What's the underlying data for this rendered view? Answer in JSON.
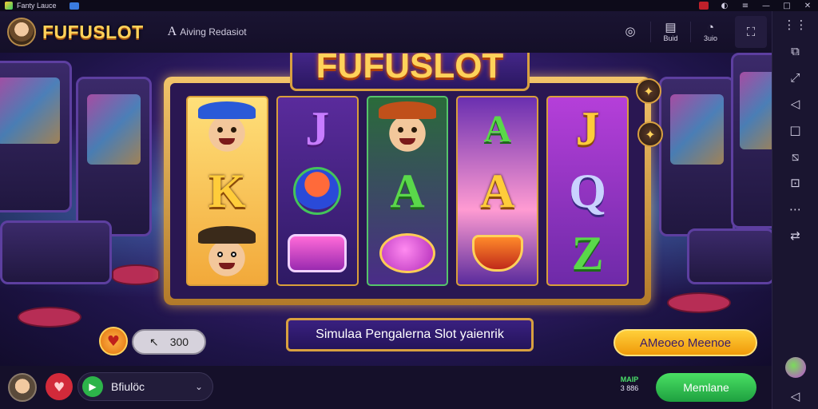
{
  "window": {
    "title": "Fanty Lauce",
    "controls": [
      "◐",
      "≡",
      "—",
      "□",
      "✕"
    ]
  },
  "header": {
    "brand": "FUFUSLOT",
    "icon_a": "A",
    "status": "Aiving Redasiot",
    "tools": [
      {
        "glyph": "◎",
        "label": ""
      },
      {
        "glyph": "▤",
        "label": "Buid"
      },
      {
        "glyph": "◔",
        "label": "3uio"
      },
      {
        "glyph": "⛶",
        "label": ""
      }
    ]
  },
  "game": {
    "logo": "FUFUSLOT",
    "reels": [
      [
        "cowboy-face",
        "K",
        "glasses-face"
      ],
      [
        "J",
        "helmet-face",
        "drum"
      ],
      [
        "hat-face",
        "A",
        "bowl"
      ],
      [
        "A-jewel",
        "A",
        "cup"
      ],
      [
        "J",
        "Q",
        "Z"
      ]
    ],
    "symbol_letters": {
      "r1s2": "K",
      "r2s1": "J",
      "r3s2": "A",
      "r4s1": "A",
      "r4s2": "A",
      "r5s1": "J",
      "r5s2": "Q",
      "r5s3": "Z"
    },
    "subtitle": "Simulaa Pengalerna Slot yaienrik",
    "credit_value": "300",
    "credit_icon": "↖",
    "auto_button": "AMeoeo Meenoe",
    "side_buttons": [
      "✦",
      "✦"
    ]
  },
  "bottom": {
    "select_label": "Bfiulöc",
    "stats_top": "MAIP",
    "stats_bottom": "3 886",
    "main_button": "Memlane"
  },
  "sidebar": {
    "items": [
      "⋮⋮",
      "⧉",
      "⤢",
      "◁",
      "□",
      "⧅",
      "⊡",
      "⋯",
      "⇄"
    ],
    "back": "◁"
  },
  "colors": {
    "accent_gold": "#ffd25a",
    "accent_green": "#2db44a",
    "bg_dark": "#15102a",
    "frame_gold": "#d8a040"
  }
}
